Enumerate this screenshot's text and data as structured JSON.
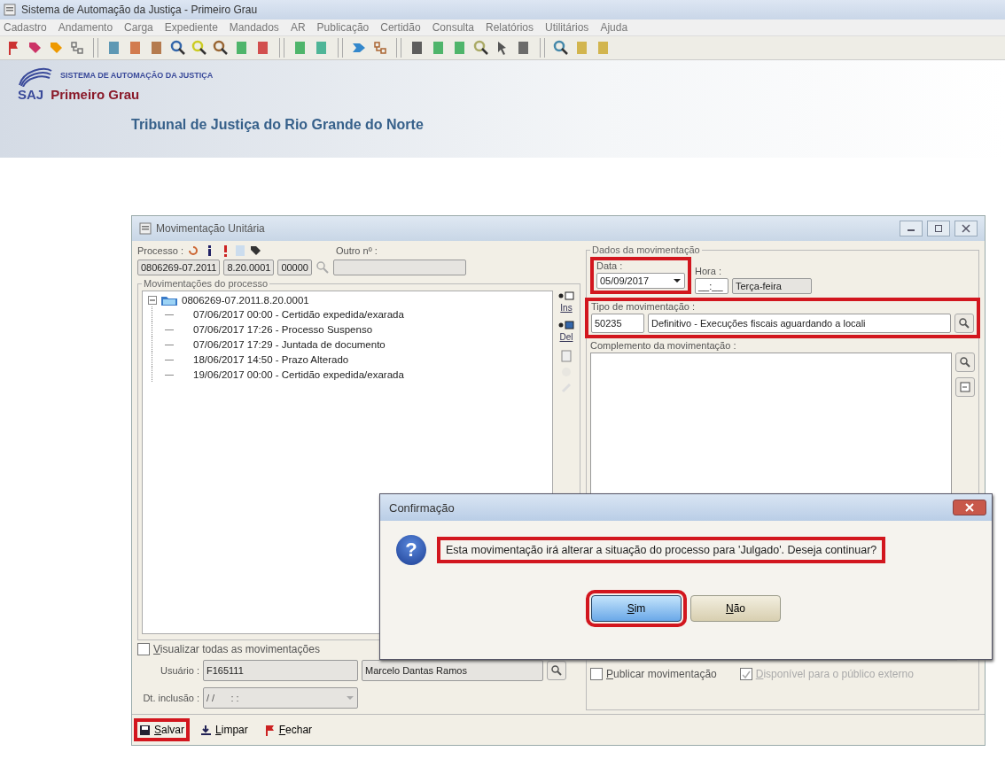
{
  "app_window": {
    "title": "Sistema de Automação da Justiça - Primeiro Grau"
  },
  "menu": [
    "Cadastro",
    "Andamento",
    "Carga",
    "Expediente",
    "Mandados",
    "AR",
    "Publicação",
    "Certidão",
    "Consulta",
    "Relatórios",
    "Utilitários",
    "Ajuda"
  ],
  "banner": {
    "logo": "SAJ",
    "system_name": "SISTEMA DE AUTOMAÇÃO DA JUSTIÇA",
    "subtitle": "Primeiro Grau",
    "court": "Tribunal de Justiça do Rio Grande do Norte"
  },
  "form_window": {
    "title": "Movimentação Unitária",
    "processo": {
      "label": "Processo :",
      "parts": [
        "0806269-07.2011",
        "8.20.0001",
        "00000"
      ],
      "other_label": "Outro nº :"
    },
    "tree": {
      "legend": "Movimentações do processo",
      "root": {
        "label": "0806269-07.2011.8.20.0001",
        "expanded": true,
        "children": [
          {
            "label": "07/06/2017 00:00 - Certidão expedida/exarada"
          },
          {
            "label": "07/06/2017 17:26 - Processo Suspenso"
          },
          {
            "label": "07/06/2017 17:29 - Juntada de documento"
          },
          {
            "label": "18/06/2017 14:50 - Prazo Alterado"
          },
          {
            "label": "19/06/2017 00:00 - Certidão expedida/exarada"
          }
        ]
      }
    },
    "side_tools": [
      "Ins",
      "Del"
    ],
    "view_all": {
      "label": "Visualizar todas as movimentações",
      "checked": false
    },
    "usuario": {
      "label": "Usuário :",
      "code": "F165111",
      "name": "Marcelo Dantas Ramos"
    },
    "dt_inclusao": {
      "label": "Dt. inclusão :",
      "value": "/ /      : :"
    },
    "dados": {
      "legend": "Dados da movimentação",
      "data_label": "Data :",
      "data": "05/09/2017",
      "hora_label": "Hora :",
      "hora": "__:__",
      "weekday": "Terça-feira",
      "tipo_label": "Tipo de movimentação :",
      "tipo_code": "50235",
      "tipo_desc": "Definitivo - Execuções fiscais aguardando a locali",
      "complemento_label": "Complemento da movimentação :"
    },
    "publicar": {
      "label": "Publicar movimentação",
      "checked": false
    },
    "disponivel": {
      "label": "Disponível para o público externo",
      "checked": true,
      "disabled": true
    },
    "actions": [
      {
        "kind": "save",
        "label": "Salvar",
        "highlighted": true
      },
      {
        "kind": "clear",
        "label": "Limpar",
        "highlighted": false
      },
      {
        "kind": "close",
        "label": "Fechar",
        "highlighted": false
      }
    ]
  },
  "dialog": {
    "title": "Confirmação",
    "icon": "?",
    "message": "Esta movimentação irá alterar a situação do processo para 'Julgado'. Deseja continuar?",
    "buttons": [
      {
        "label": "Sim",
        "selected": true
      },
      {
        "label": "Não",
        "selected": false
      }
    ]
  }
}
